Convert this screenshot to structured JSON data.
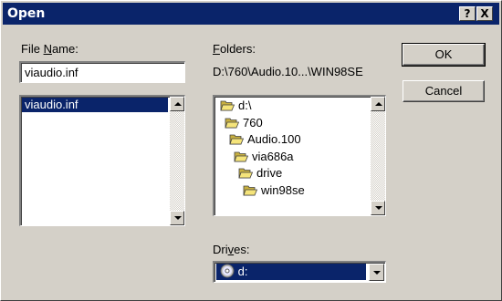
{
  "window": {
    "title": "Open",
    "help_glyph": "?",
    "close_glyph": "X"
  },
  "filename": {
    "label_mnemonic": "N",
    "label_pre": "File ",
    "label_post": "ame:",
    "value": "viaudio.inf",
    "list": [
      "viaudio.inf"
    ],
    "selected_index": 0
  },
  "folders": {
    "label_mnemonic": "F",
    "label_post": "olders:",
    "current_path": "D:\\760\\Audio.10...\\WIN98SE",
    "tree": [
      "d:\\",
      "760",
      "Audio.100",
      "via686a",
      "drive",
      "win98se"
    ],
    "open_icon": "open-folder-icon"
  },
  "buttons": {
    "ok": "OK",
    "cancel": "Cancel"
  },
  "drives": {
    "label_pre": "Dri",
    "label_mnemonic": "v",
    "label_post": "es:",
    "value": "d:",
    "icon": "cd-drive-icon"
  },
  "colors": {
    "selection": "#0a246a",
    "face": "#d4d0c8",
    "folder": "#f5e47a"
  }
}
